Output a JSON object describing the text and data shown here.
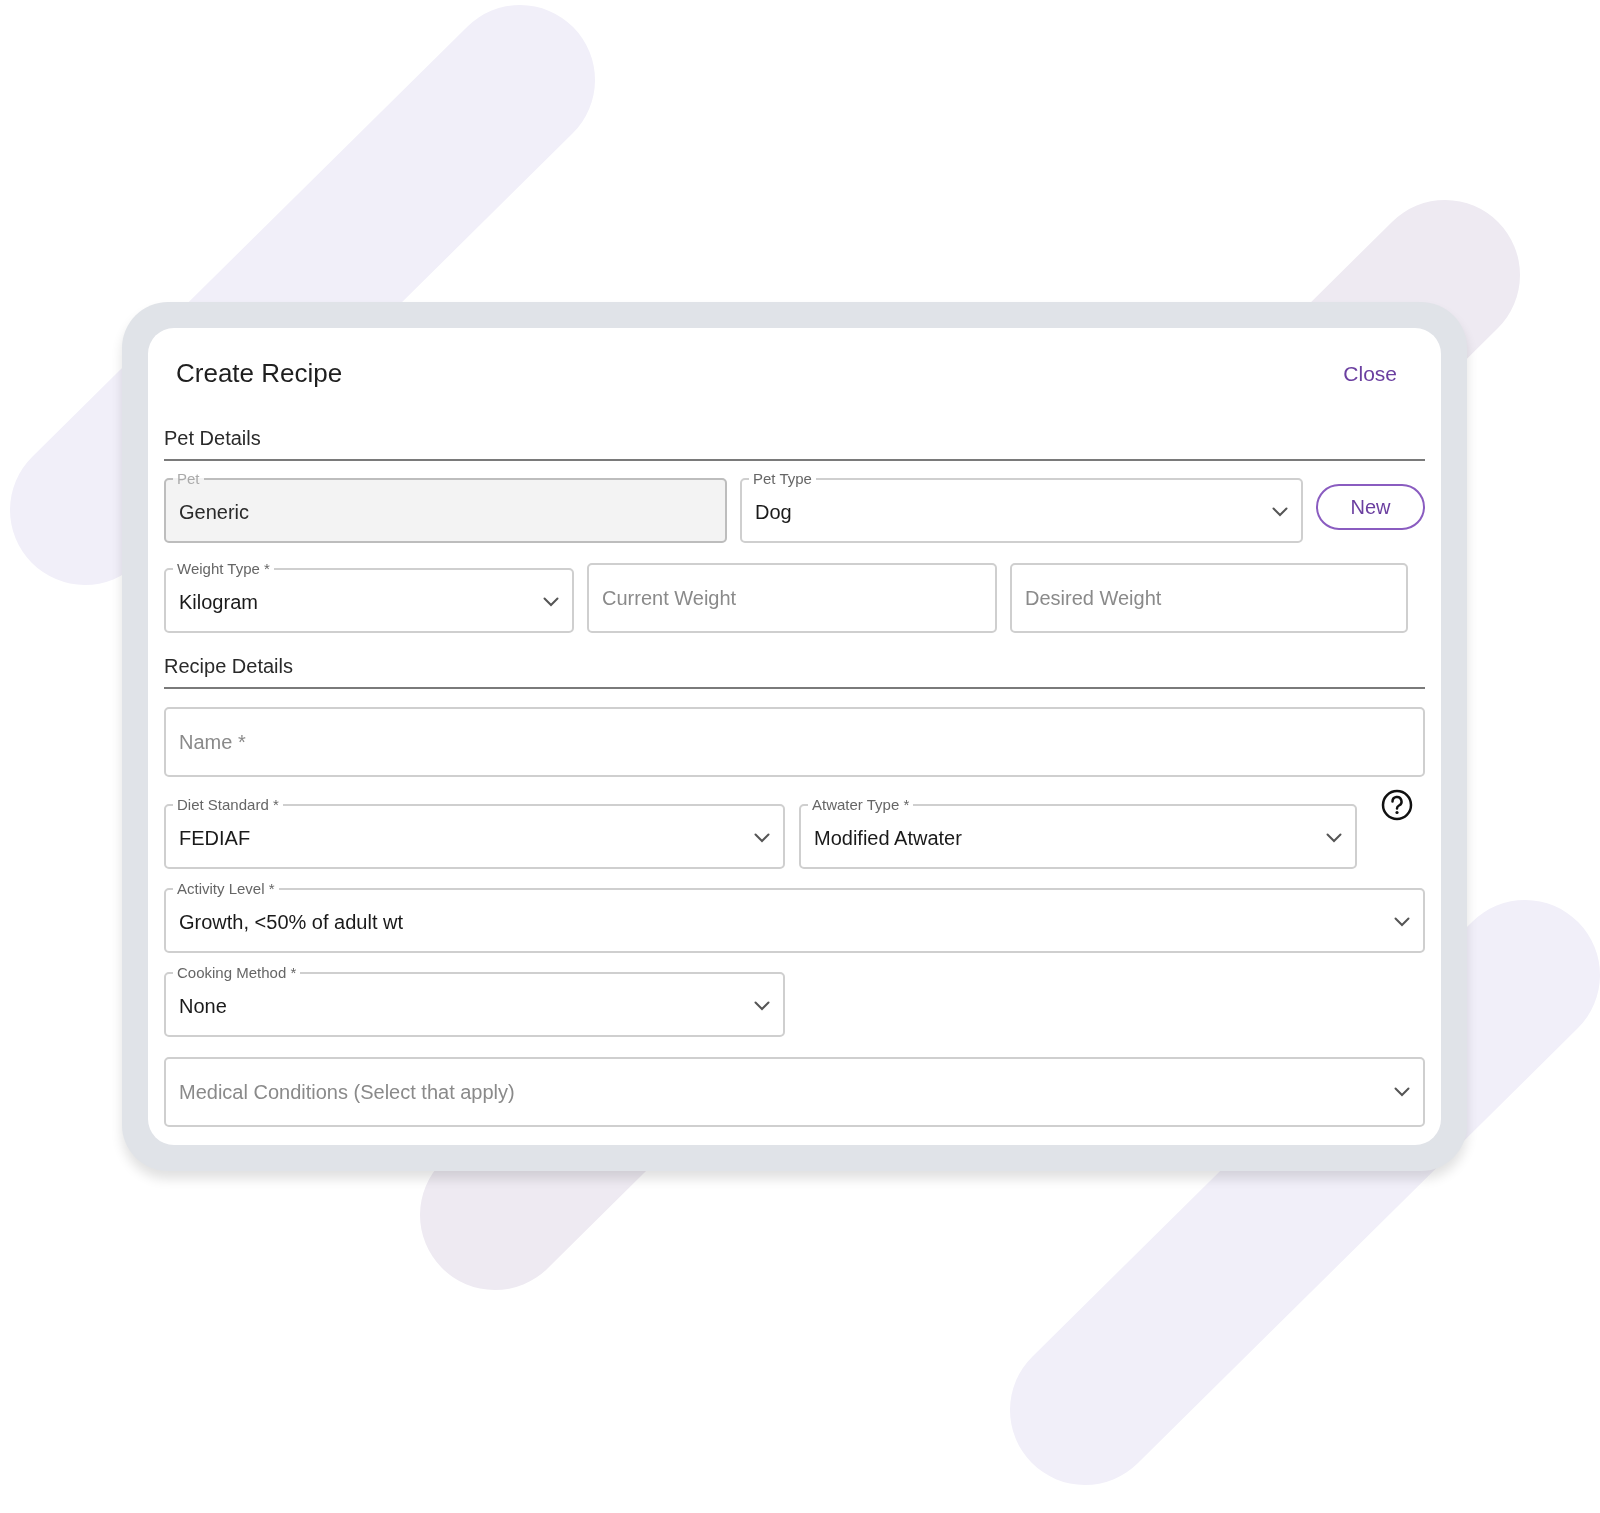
{
  "dialog": {
    "title": "Create Recipe",
    "close": "Close"
  },
  "sections": [
    {
      "heading": "Pet Details",
      "rows": [
        [
          {
            "kind": "text",
            "label": "Pet",
            "value": "Generic",
            "disabled": true
          },
          {
            "kind": "select",
            "label": "Pet Type",
            "value": "Dog"
          },
          {
            "kind": "button",
            "label": "New"
          }
        ],
        [
          {
            "kind": "select",
            "label": "Weight Type *",
            "value": "Kilogram"
          },
          {
            "kind": "text",
            "placeholder": "Current Weight"
          },
          {
            "kind": "text",
            "placeholder": "Desired Weight"
          }
        ]
      ]
    },
    {
      "heading": "Recipe Details",
      "rows": [
        [
          {
            "kind": "text",
            "placeholder": "Name *"
          }
        ],
        [
          {
            "kind": "select",
            "label": "Diet Standard *",
            "value": "FEDIAF"
          },
          {
            "kind": "select",
            "label": "Atwater Type *",
            "value": "Modified Atwater"
          },
          {
            "kind": "help"
          }
        ],
        [
          {
            "kind": "select",
            "label": "Activity Level *",
            "value": "Growth, <50% of adult wt"
          }
        ],
        [
          {
            "kind": "select",
            "label": "Cooking Method *",
            "value": "None"
          }
        ],
        [
          {
            "kind": "select",
            "placeholder": "Medical Conditions (Select that apply)"
          }
        ]
      ]
    }
  ]
}
